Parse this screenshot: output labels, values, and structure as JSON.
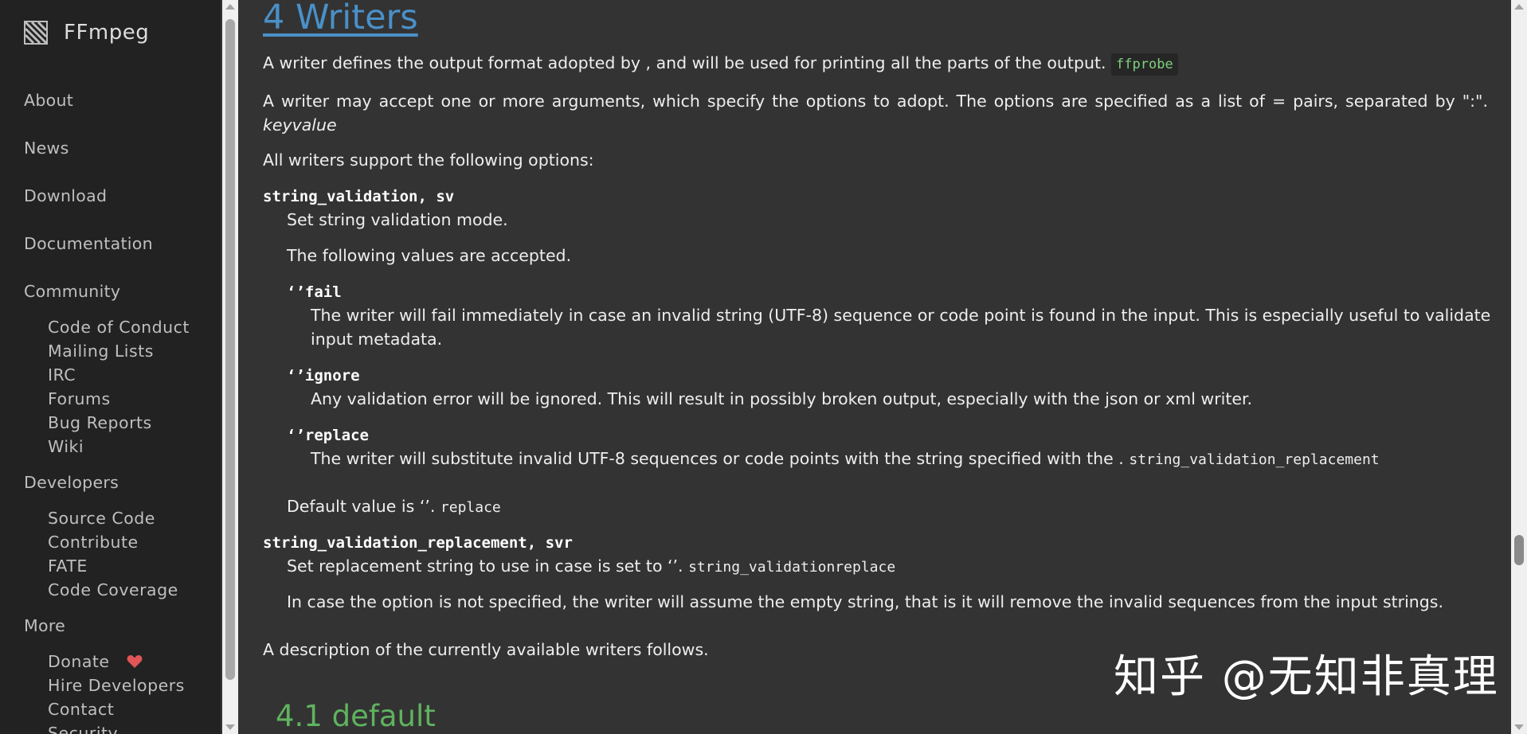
{
  "sidebar": {
    "brand": "FFmpeg",
    "nav": [
      "About",
      "News",
      "Download",
      "Documentation",
      "Community"
    ],
    "community_items": [
      "Code of Conduct",
      "Mailing Lists",
      "IRC",
      "Forums",
      "Bug Reports",
      "Wiki"
    ],
    "developers_label": "Developers",
    "developers_items": [
      "Source Code",
      "Contribute",
      "FATE",
      "Code Coverage"
    ],
    "more_label": "More",
    "more_items": [
      "Donate",
      "Hire Developers",
      "Contact",
      "Security"
    ],
    "heart_color": "#e05555"
  },
  "content": {
    "heading": "4 Writers",
    "p1_text": "A writer defines the output format adopted by , and will be used for printing all the parts of the output.",
    "p1_code": "ffprobe",
    "p2_text": "A writer may accept one or more arguments, which specify the options to adopt. The options are specified as a list of = pairs, separated by \":\".",
    "p2_em": "keyvalue",
    "p3": "All writers support the following options:",
    "opt1_term": "string_validation, sv",
    "opt1_desc": "Set string validation mode.",
    "opt1_values_intro": "The following values are accepted.",
    "values": [
      {
        "term": "‘’fail",
        "desc_line1": "The writer will fail immediately in case an invalid string (UTF-8) sequence or code point is found in the input. This is especially useful to validate",
        "desc_line2": "input metadata."
      },
      {
        "term": "‘’ignore",
        "desc": "Any validation error will be ignored. This will result in possibly broken output, especially with the json or xml writer."
      },
      {
        "term": "‘’replace",
        "desc": "The writer will substitute invalid UTF-8 sequences or code points with the string specified with the .",
        "desc_code": "string_validation_replacement"
      }
    ],
    "opt1_default_text": "Default value is ‘’.",
    "opt1_default_code": "replace",
    "opt2_term": "string_validation_replacement, svr",
    "opt2_desc_text": "Set replacement string to use in case is set to ‘’.",
    "opt2_desc_code": "string_validationreplace",
    "opt2_note": "In case the option is not specified, the writer will assume the empty string, that is it will remove the invalid sequences from the input strings.",
    "p_final": "A description of the currently available writers follows.",
    "subheading": "4.1 default"
  },
  "watermark": "知乎 @无知非真理",
  "colors": {
    "link": "#4a90c8",
    "subheading": "#5fb35f",
    "code_pill_text": "#7fd07f",
    "background": "#333333",
    "sidebar_bg": "#222222"
  }
}
